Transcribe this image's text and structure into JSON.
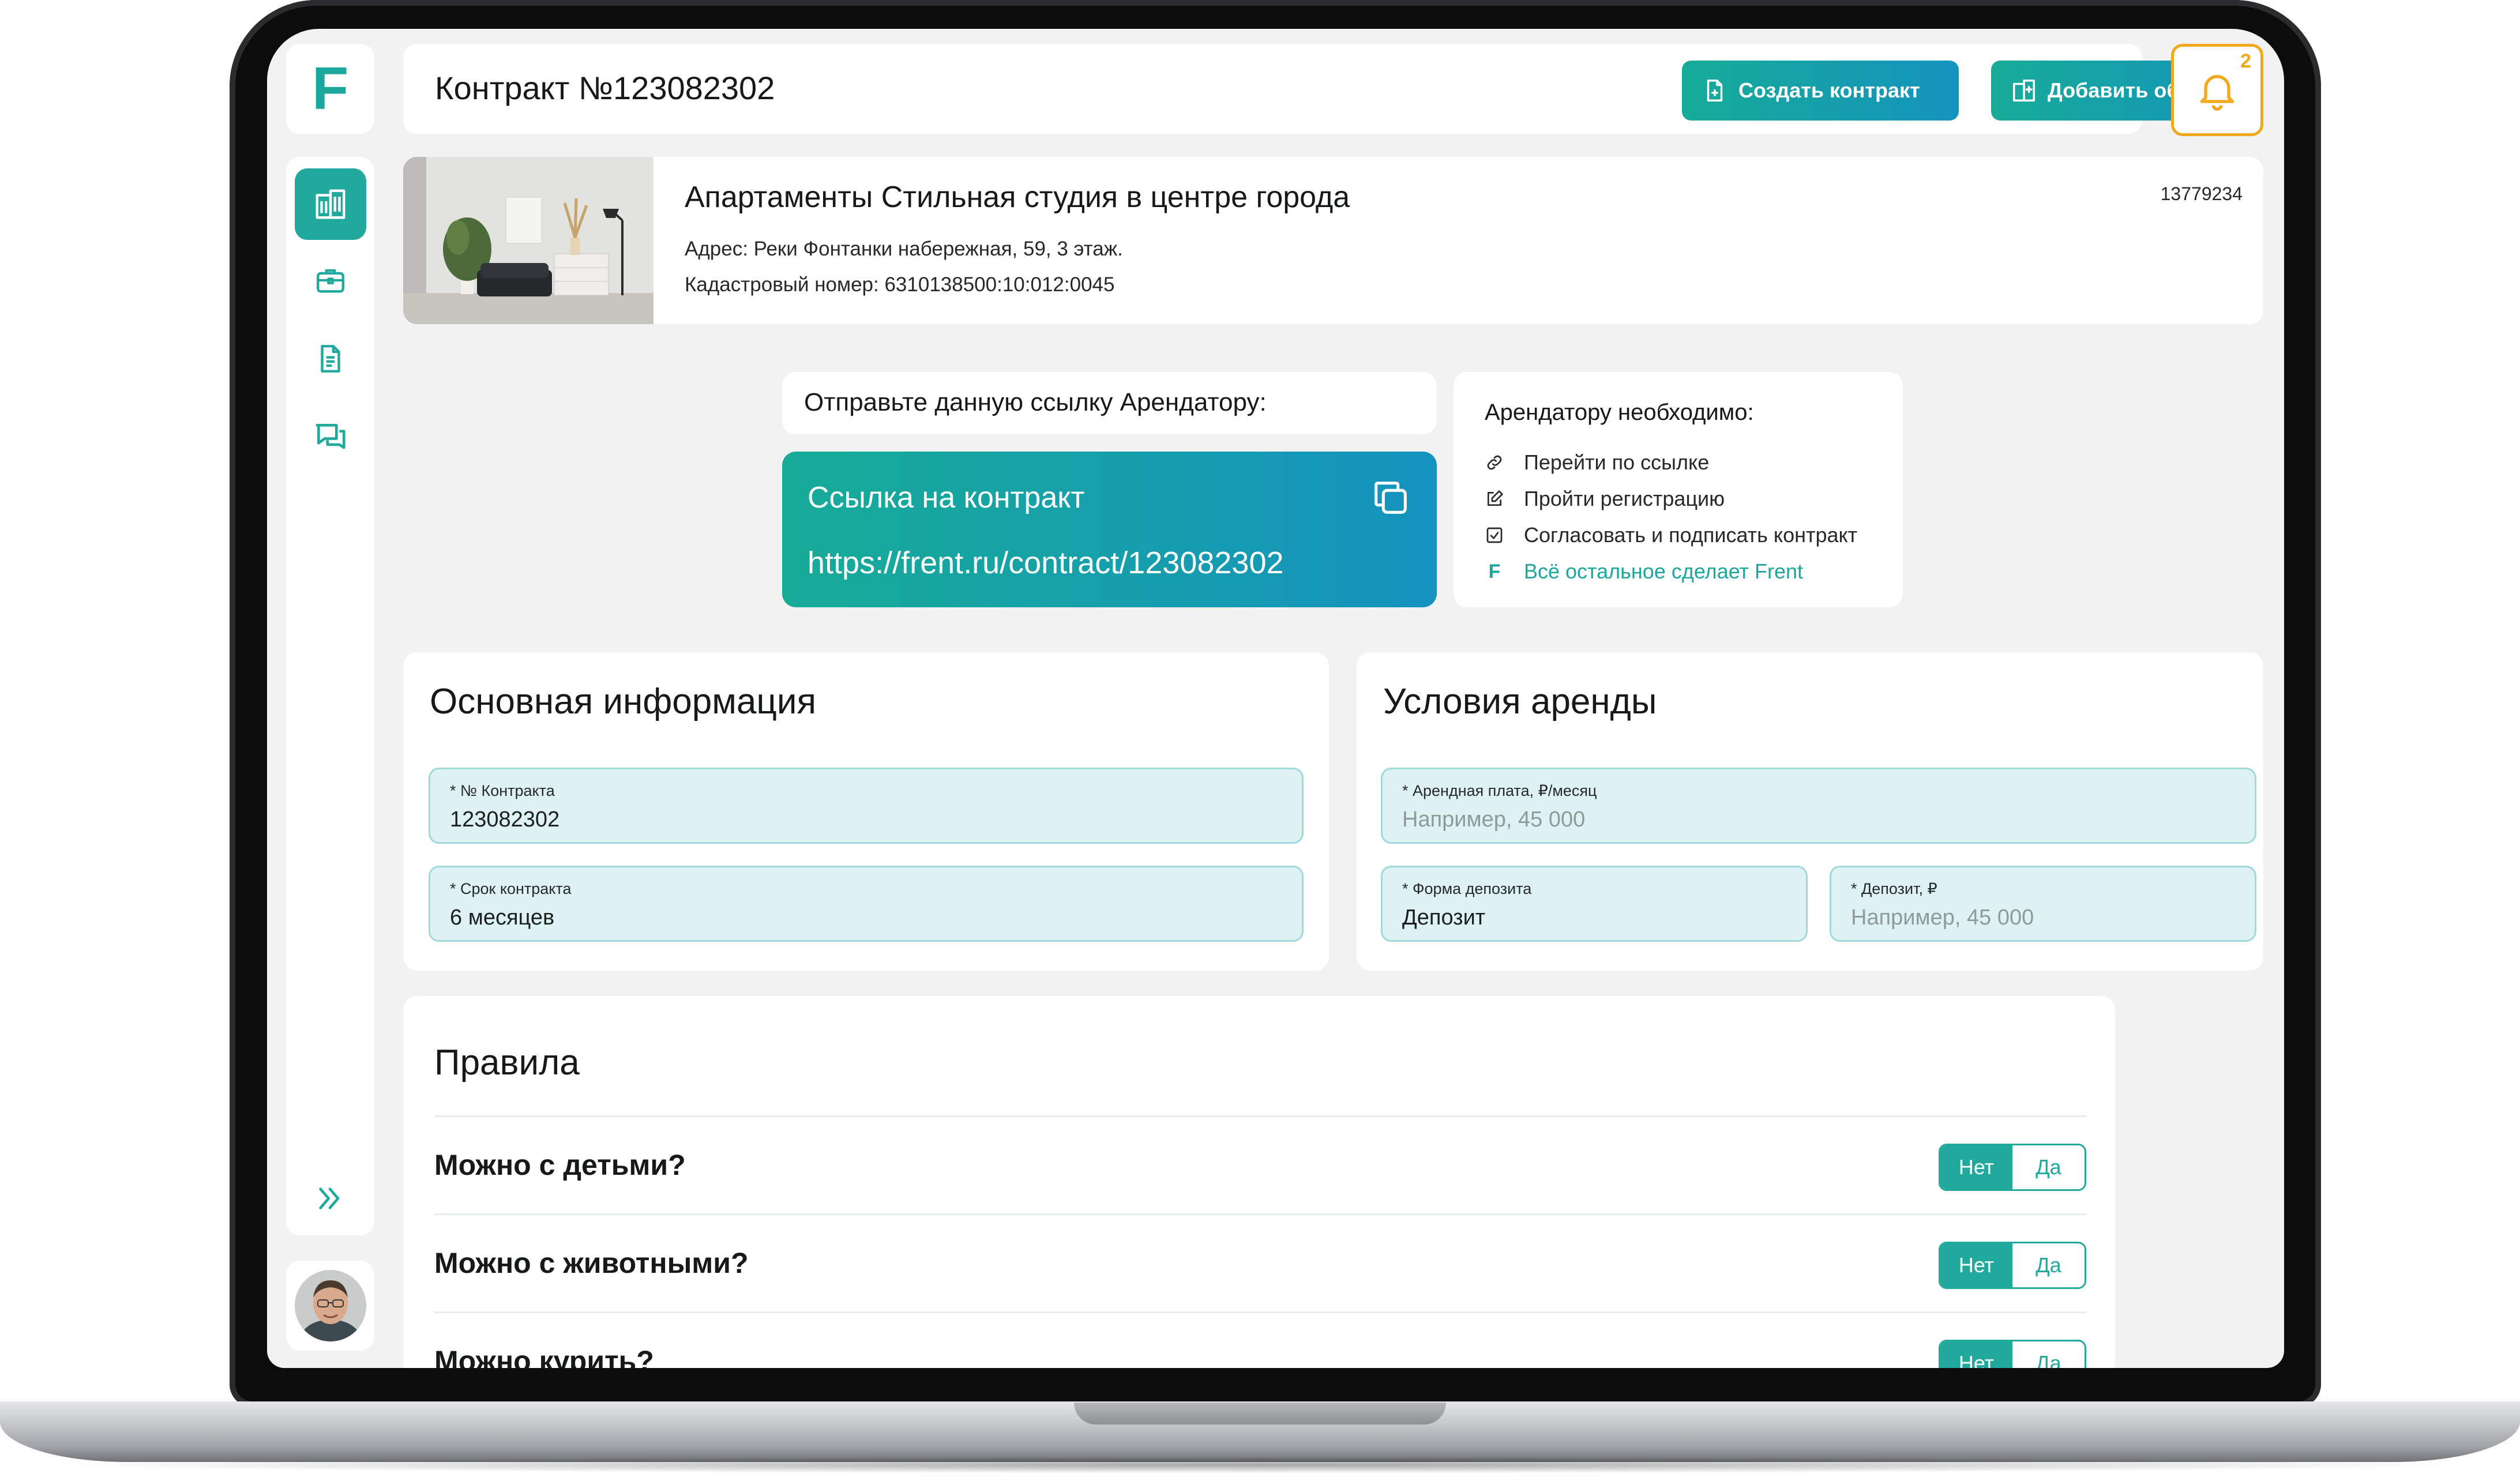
{
  "brand": {
    "logo_letter": "F",
    "accent": "#20a99c",
    "gradient_from": "#17ab97",
    "gradient_to": "#1493bf",
    "notify_color": "#f1a91a"
  },
  "sidebar": {
    "items": [
      {
        "icon": "building-icon",
        "active": true
      },
      {
        "icon": "briefcase-icon",
        "active": false
      },
      {
        "icon": "document-icon",
        "active": false
      },
      {
        "icon": "chat-icon",
        "active": false
      }
    ],
    "expand_icon": "double-chevron-right-icon"
  },
  "header": {
    "title": "Контракт №123082302",
    "create_contract_label": "Создать контракт",
    "add_object_label": "Добавить объект",
    "notifications_count": "2"
  },
  "property": {
    "title": "Апартаменты Стильная студия в центре города",
    "address": "Адрес: Реки Фонтанки набережная, 59, 3 этаж.",
    "cadastral": "Кадастровый номер: 6310138500:10:012:0045",
    "id": "13779234"
  },
  "share": {
    "instruction": "Отправьте данную ссылку Арендатору:",
    "link_title": "Ссылка на контракт",
    "link_url": "https://frent.ru/contract/123082302"
  },
  "requirements": {
    "title": "Арендатору необходимо:",
    "steps": [
      {
        "icon": "link-icon",
        "label": "Перейти по ссылке"
      },
      {
        "icon": "edit-icon",
        "label": "Пройти регистрацию"
      },
      {
        "icon": "checkbox-icon",
        "label": "Согласовать и подписать контракт"
      },
      {
        "icon": "frent-logo-icon",
        "label": "Всё остальное сделает Frent"
      }
    ]
  },
  "basic_info": {
    "title": "Основная информация",
    "contract_no_label": "* № Контракта",
    "contract_no_value": "123082302",
    "term_label": "* Срок контракта",
    "term_value": "6 месяцев"
  },
  "rent_terms": {
    "title": "Условия аренды",
    "rent_label": "* Арендная плата, ₽/месяц",
    "rent_placeholder": "Например, 45 000",
    "deposit_form_label": "* Форма депозита",
    "deposit_form_value": "Депозит",
    "deposit_label": "* Депозит, ₽",
    "deposit_placeholder": "Например, 45 000"
  },
  "rules": {
    "title": "Правила",
    "items": [
      {
        "question": "Можно с детьми?",
        "no": "Нет",
        "yes": "Да",
        "selected": "no"
      },
      {
        "question": "Можно с животными?",
        "no": "Нет",
        "yes": "Да",
        "selected": "no"
      },
      {
        "question": "Можно курить?",
        "no": "Нет",
        "yes": "Да",
        "selected": "no"
      }
    ]
  }
}
